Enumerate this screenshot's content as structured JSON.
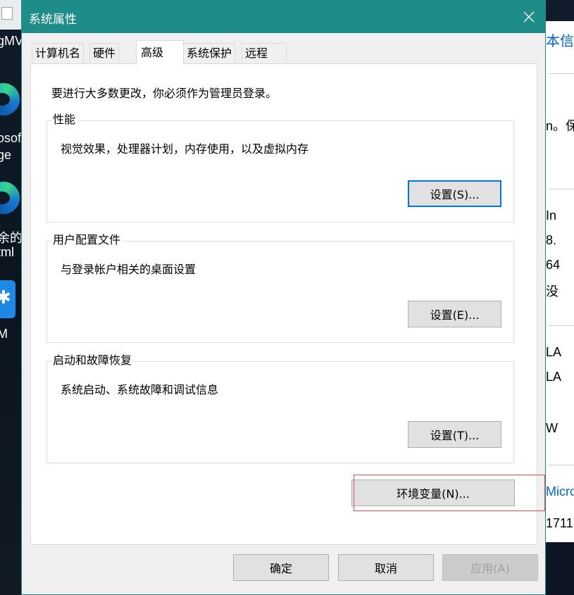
{
  "desktop": {
    "labels": [
      "gMV",
      "osof",
      "ge",
      "余的J",
      "tml",
      "M"
    ]
  },
  "background_window": {
    "texts": [
      "本信息",
      "n。保",
      "In",
      "8.",
      "64",
      "没",
      "LA",
      "LA",
      "W",
      "Micro",
      "1711"
    ]
  },
  "dialog": {
    "title": "系统属性",
    "close_symbol": "✕",
    "tabs": [
      {
        "label": "计算机名",
        "active": false
      },
      {
        "label": "硬件",
        "active": false
      },
      {
        "label": "高级",
        "active": true
      },
      {
        "label": "系统保护",
        "active": false
      },
      {
        "label": "远程",
        "active": false
      }
    ],
    "intro": "要进行大多数更改，你必须作为管理员登录。",
    "groups": {
      "performance": {
        "title": "性能",
        "description": "视觉效果，处理器计划，内存使用，以及虚拟内存",
        "button": "设置(S)..."
      },
      "user_profiles": {
        "title": "用户配置文件",
        "description": "与登录帐户相关的桌面设置",
        "button": "设置(E)..."
      },
      "startup_recovery": {
        "title": "启动和故障恢复",
        "description": "系统启动、系统故障和调试信息",
        "button": "设置(T)..."
      }
    },
    "env_button": "环境变量(N)...",
    "footer": {
      "ok": "确定",
      "cancel": "取消",
      "apply": "应用(A)"
    }
  },
  "colors": {
    "titlebar": "#1e8c89",
    "accent_focus": "#0078d7",
    "highlight_box": "#e05050"
  }
}
